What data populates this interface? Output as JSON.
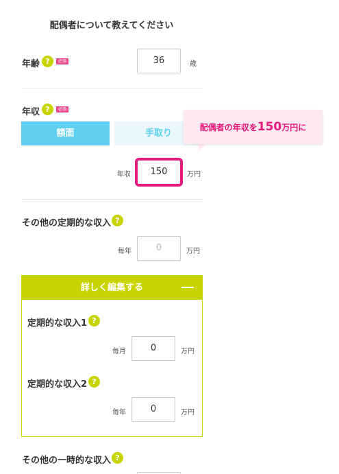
{
  "page_title": "配偶者について教えてください",
  "age": {
    "label": "年齢",
    "help": "?",
    "required": "必須",
    "value": "36",
    "unit": "歳"
  },
  "income": {
    "label": "年収",
    "help": "?",
    "required": "必須",
    "toggle_gross": "額面",
    "toggle_net": "手取り",
    "prefix": "年収",
    "value": "150",
    "unit": "万円"
  },
  "callout": {
    "text_before": "配偶者の年収を",
    "text_value": "150",
    "text_after": "万円に"
  },
  "other_regular_income": {
    "label": "その他の定期的な収入",
    "help": "?",
    "prefix": "毎年",
    "placeholder": "0",
    "unit": "万円"
  },
  "detail_panel": {
    "header": "詳しく編集する",
    "items": [
      {
        "label": "定期的な収入1",
        "help": "?",
        "prefix": "毎月",
        "value": "0",
        "unit": "万円"
      },
      {
        "label": "定期的な収入2",
        "help": "?",
        "prefix": "毎年",
        "value": "0",
        "unit": "万円"
      }
    ]
  },
  "other_onetime_income": {
    "label": "その他の一時的な収入",
    "help": "?"
  },
  "colors": {
    "accent_green": "#c8d400",
    "accent_blue": "#5fd0ef",
    "highlight_pink": "#e6197d",
    "required_pink": "#ea4a8c"
  }
}
